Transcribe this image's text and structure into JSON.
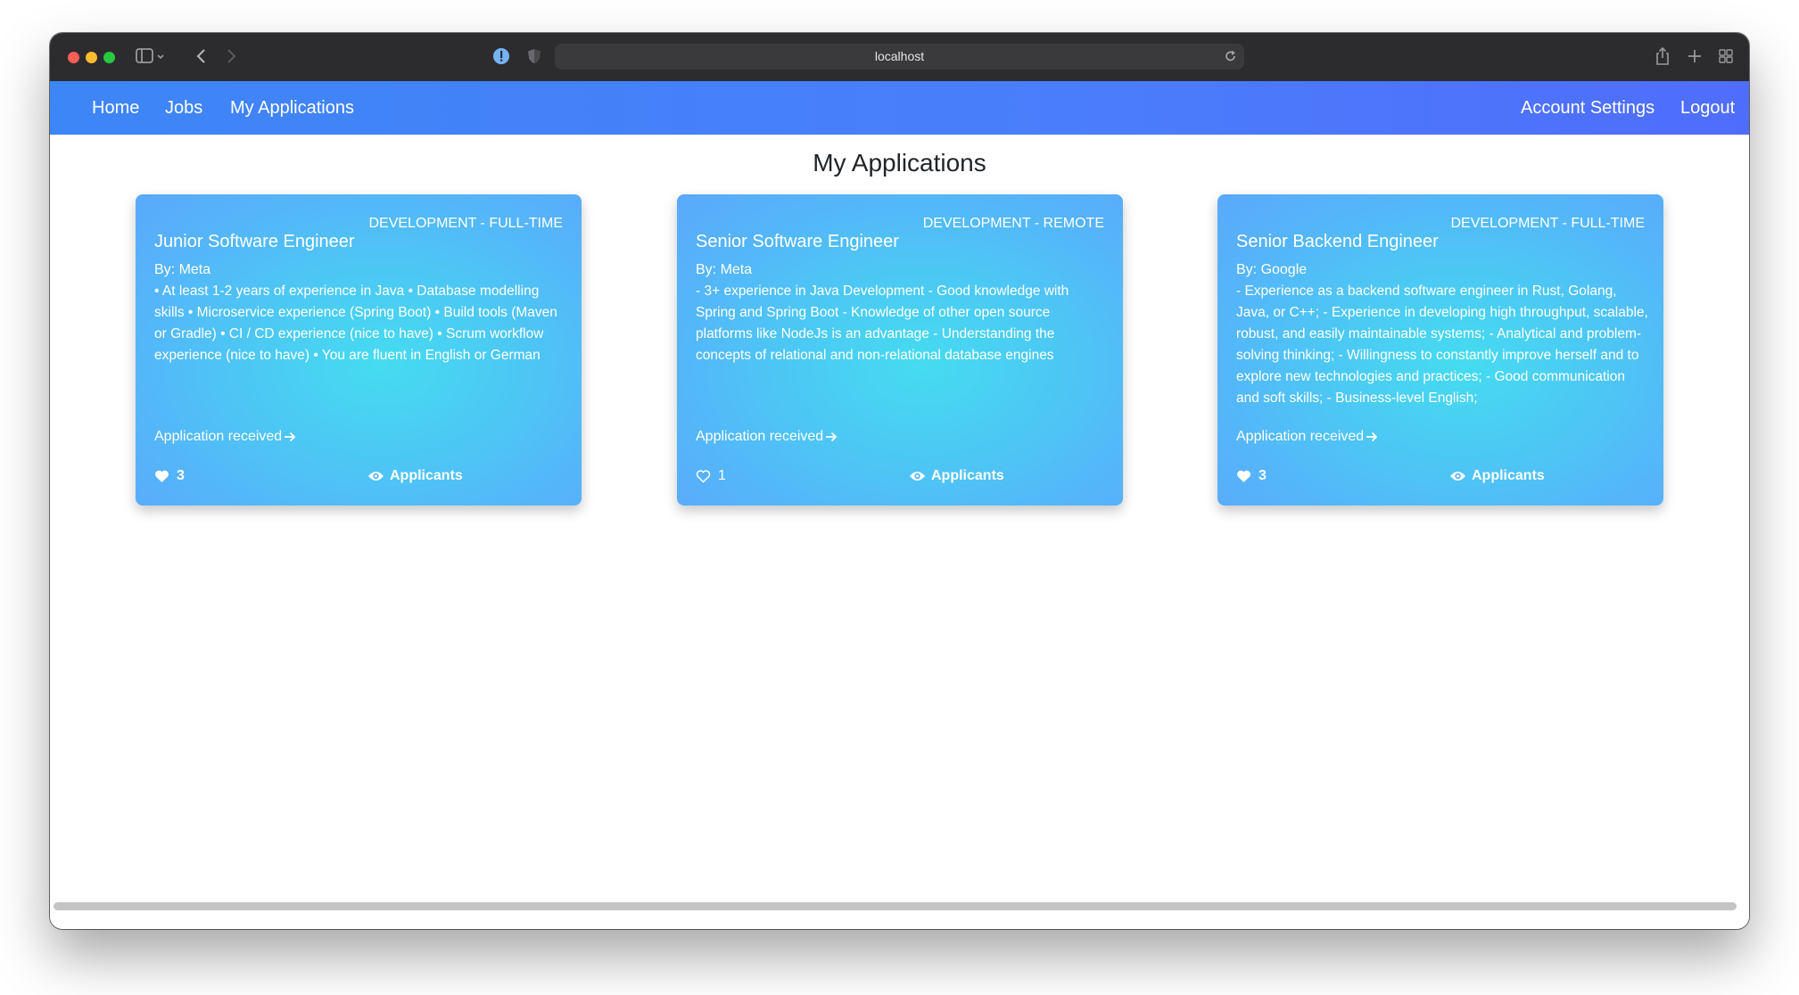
{
  "browser": {
    "url": "localhost"
  },
  "navbar": {
    "left_links": [
      "Home",
      "Jobs",
      "My Applications"
    ],
    "right_links": [
      "Account Settings",
      "Logout"
    ]
  },
  "page": {
    "title": "My Applications"
  },
  "cards": [
    {
      "category": "DEVELOPMENT - FULL-TIME",
      "title": "Junior Software Engineer",
      "company": "By: Meta",
      "description": "• At least 1-2 years of experience in Java • Database modelling skills • Microservice experience (Spring Boot) • Build tools (Maven or Gradle) • CI / CD experience (nice to have) • Scrum workflow experience (nice to have) • You are fluent in English or German",
      "status": "Application received",
      "likes": "3",
      "liked": true,
      "applicants_label": "Applicants"
    },
    {
      "category": "DEVELOPMENT - REMOTE",
      "title": "Senior Software Engineer",
      "company": "By: Meta",
      "description": "- 3+ experience in Java Development - Good knowledge with Spring and Spring Boot - Knowledge of other open source platforms like NodeJs is an advantage - Understanding the concepts of relational and non-relational database engines",
      "status": "Application received",
      "likes": "1",
      "liked": false,
      "applicants_label": "Applicants"
    },
    {
      "category": "DEVELOPMENT - FULL-TIME",
      "title": "Senior Backend Engineer",
      "company": "By: Google",
      "description": "- Experience as a backend software engineer in Rust, Golang, Java, or C++; - Experience in developing high throughput, scalable, robust, and easily maintainable systems; - Analytical and problem-solving thinking; - Willingness to constantly improve herself and to explore new technologies and practices; - Good communication and soft skills; - Business-level English;",
      "status": "Application received",
      "likes": "3",
      "liked": true,
      "applicants_label": "Applicants"
    }
  ],
  "colors": {
    "navbar": "#4a7dfb",
    "card_center": "#45dcf0",
    "card_edge": "#5aa9fb"
  }
}
